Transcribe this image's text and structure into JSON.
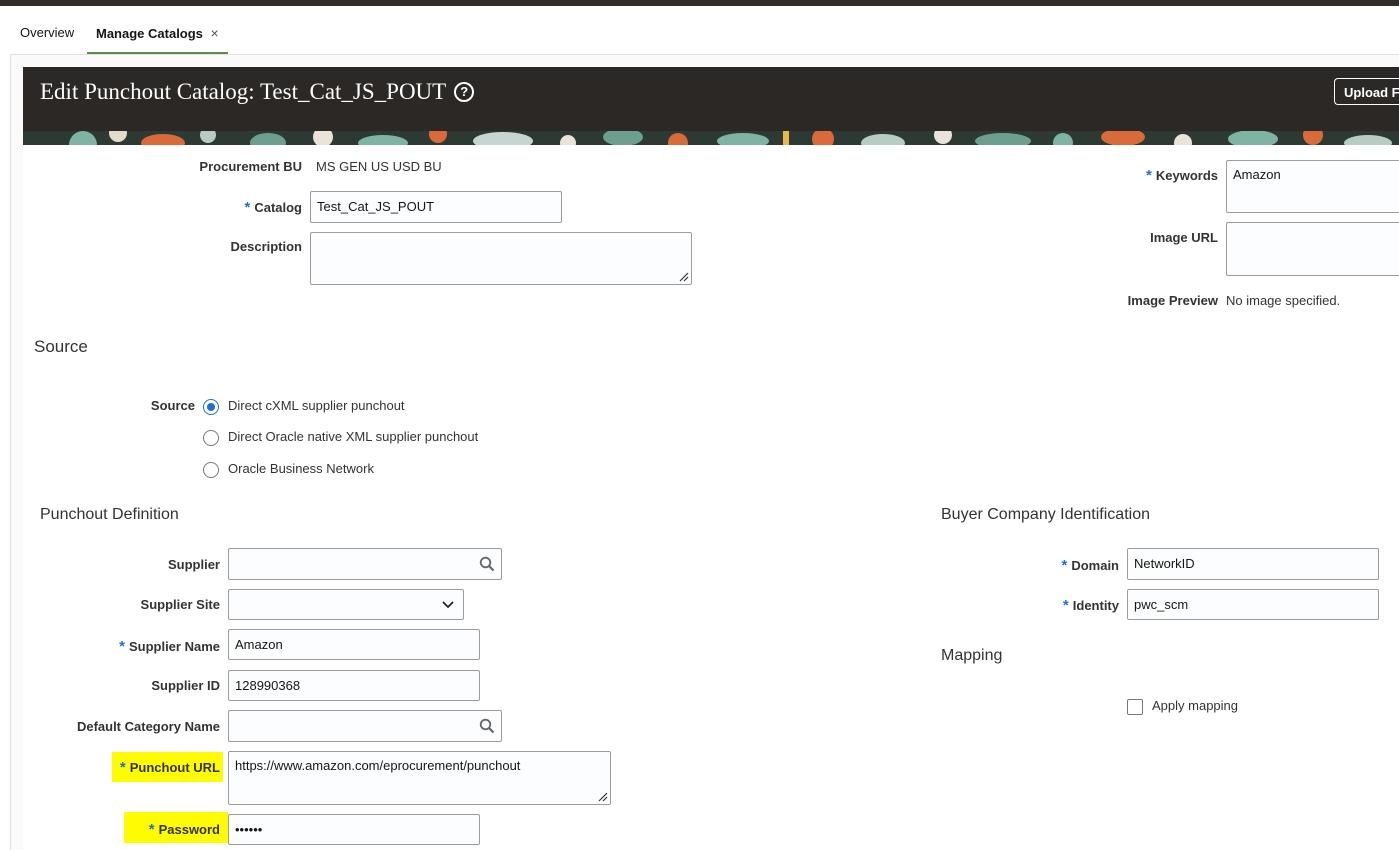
{
  "tabs": {
    "overview": "Overview",
    "manage_catalogs": "Manage Catalogs",
    "close_glyph": "×"
  },
  "header": {
    "title": "Edit Punchout Catalog: Test_Cat_JS_POUT",
    "help_glyph": "?",
    "upload_button": "Upload F",
    "background_color": "#2b2825"
  },
  "general": {
    "procurement_bu_label": "Procurement BU",
    "procurement_bu_value": "MS GEN US USD BU",
    "catalog_label": "Catalog",
    "catalog_value": "Test_Cat_JS_POUT",
    "description_label": "Description",
    "description_value": "",
    "keywords_label": "Keywords",
    "keywords_value": "Amazon",
    "image_url_label": "Image URL",
    "image_url_value": "",
    "image_preview_label": "Image Preview",
    "image_preview_value": "No image specified."
  },
  "source": {
    "heading": "Source",
    "label": "Source",
    "options": [
      {
        "label": "Direct cXML supplier punchout",
        "selected": true
      },
      {
        "label": "Direct Oracle native XML supplier punchout",
        "selected": false
      },
      {
        "label": "Oracle Business Network",
        "selected": false
      }
    ]
  },
  "punchout_definition": {
    "heading": "Punchout Definition",
    "supplier_label": "Supplier",
    "supplier_value": "",
    "supplier_site_label": "Supplier Site",
    "supplier_site_value": "",
    "supplier_name_label": "Supplier Name",
    "supplier_name_value": "Amazon",
    "supplier_id_label": "Supplier ID",
    "supplier_id_value": "128990368",
    "default_category_label": "Default Category Name",
    "default_category_value": "",
    "punchout_url_label": "Punchout URL",
    "punchout_url_value": "https://www.amazon.com/eprocurement/punchout",
    "password_label": "Password",
    "password_value": "••••••"
  },
  "buyer_company": {
    "heading": "Buyer Company Identification",
    "domain_label": "Domain",
    "domain_value": "NetworkID",
    "identity_label": "Identity",
    "identity_value": "pwc_scm"
  },
  "mapping": {
    "heading": "Mapping",
    "apply_mapping_label": "Apply mapping",
    "apply_mapping_checked": false
  },
  "required_marker": "*",
  "colors": {
    "accent": "#1e6fd9",
    "highlight": "#fffb00",
    "tab_underline": "#5d8a4e"
  }
}
